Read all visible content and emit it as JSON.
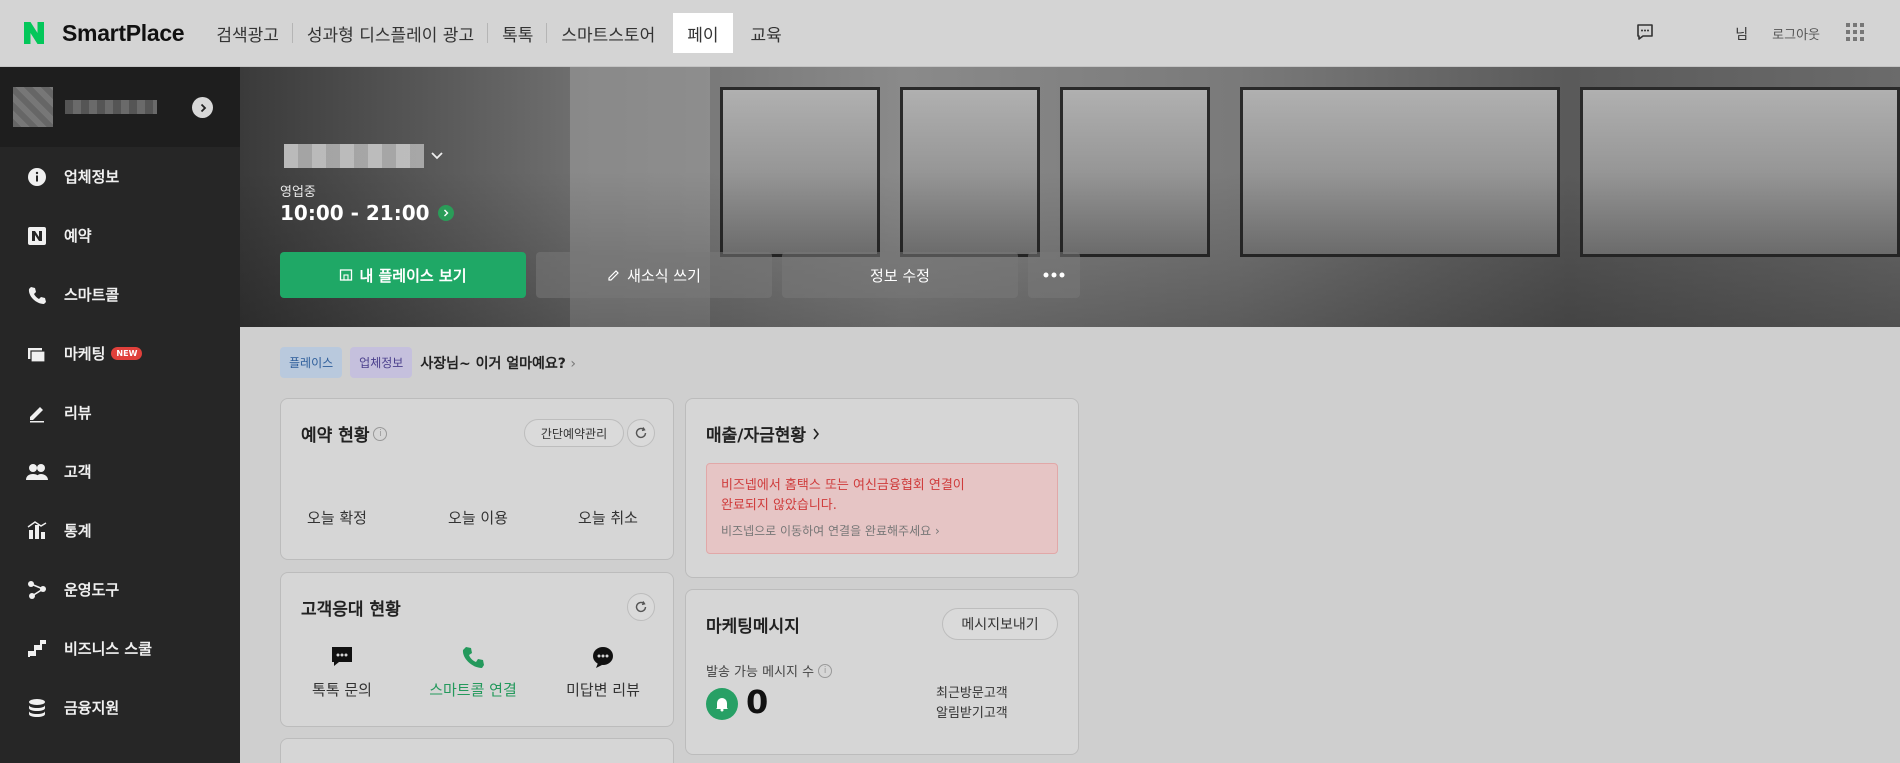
{
  "brand": {
    "name": "SmartPlace",
    "accent": "#03c75a"
  },
  "topnav": {
    "items": [
      {
        "label": "검색광고"
      },
      {
        "label": "성과형 디스플레이 광고"
      },
      {
        "label": "톡톡"
      },
      {
        "label": "스마트스토어"
      },
      {
        "label": "페이",
        "active": true
      },
      {
        "label": "교육"
      }
    ],
    "user_suffix": "님",
    "logout": "로그아웃"
  },
  "sidebar": {
    "items": [
      {
        "label": "업체정보",
        "icon": "info-icon"
      },
      {
        "label": "예약",
        "icon": "naver-booking-icon"
      },
      {
        "label": "스마트콜",
        "icon": "phone-icon"
      },
      {
        "label": "마케팅",
        "icon": "marketing-icon",
        "badge": "NEW"
      },
      {
        "label": "리뷰",
        "icon": "pencil-icon"
      },
      {
        "label": "고객",
        "icon": "people-icon"
      },
      {
        "label": "통계",
        "icon": "stats-icon"
      },
      {
        "label": "운영도구",
        "icon": "tools-icon"
      },
      {
        "label": "비즈니스 스쿨",
        "icon": "school-icon"
      },
      {
        "label": "금융지원",
        "icon": "finance-icon"
      }
    ]
  },
  "hero": {
    "status": "영업중",
    "hours": "10:00 - 21:00",
    "buttons": {
      "view_place": "내 플레이스 보기",
      "write_news": "새소식 쓰기",
      "edit_info": "정보 수정"
    }
  },
  "crumbs": {
    "tag_place": "플레이스",
    "tag_biz": "업체정보",
    "text": "사장님~ 이거 얼마예요?"
  },
  "reservation": {
    "title": "예약 현황",
    "manage": "간단예약관리",
    "today_confirmed": "오늘 확정",
    "today_used": "오늘 이용",
    "today_canceled": "오늘 취소"
  },
  "customer_service": {
    "title": "고객응대 현황",
    "talk": "톡톡 문의",
    "smartcall": "스마트콜 연결",
    "unanswered": "미답변 리뷰"
  },
  "sales": {
    "title": "매출/자금현황",
    "alert_line1": "비즈넵에서 홈택스 또는 여신금융협회 연결이",
    "alert_line2": "완료되지 않았습니다.",
    "alert_link": "비즈넵으로 이동하여 연결을 완료해주세요"
  },
  "marketing_msg": {
    "title": "마케팅메시지",
    "send": "메시지보내기",
    "available_label": "발송 가능 메시지 수",
    "count": "0",
    "recent_visitors": "최근방문고객",
    "alarm_customers": "알림받기고객"
  }
}
